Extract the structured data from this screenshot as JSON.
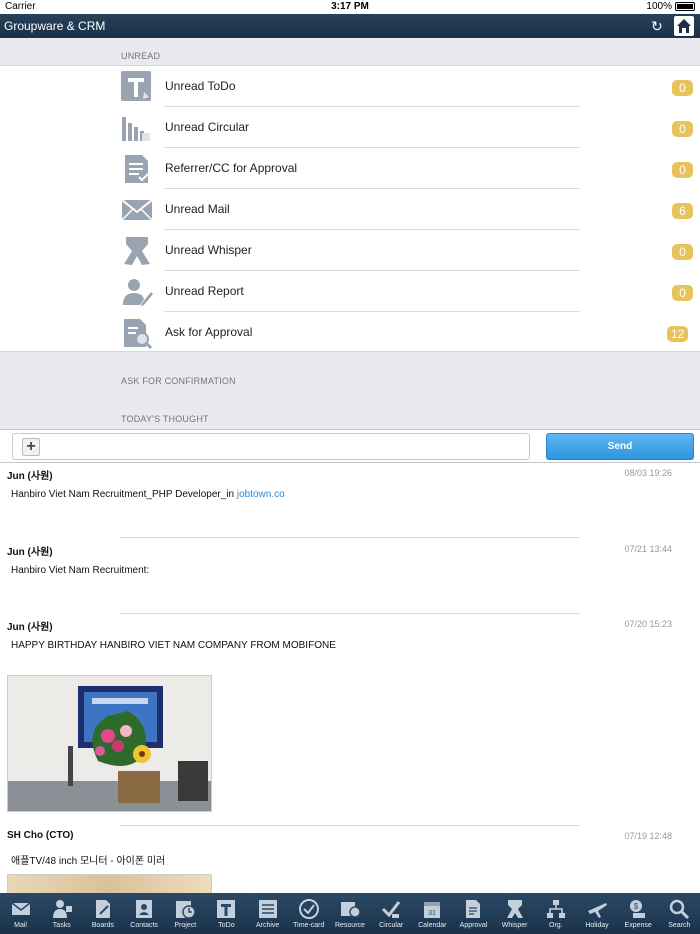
{
  "status_bar": {
    "carrier": "Carrier",
    "time": "3:17 PM",
    "battery": "100%"
  },
  "nav": {
    "title": "Groupware & CRM"
  },
  "sections": {
    "unread": "UNREAD",
    "confirmation": "ASK FOR CONFIRMATION",
    "thought": "TODAY'S THOUGHT"
  },
  "unread_items": [
    {
      "label": "Unread ToDo",
      "count": "0",
      "icon": "todo-icon"
    },
    {
      "label": "Unread Circular",
      "count": "0",
      "icon": "circular-icon"
    },
    {
      "label": "Referrer/CC for Approval",
      "count": "0",
      "icon": "document-check-icon"
    },
    {
      "label": "Unread Mail",
      "count": "6",
      "icon": "mail-icon"
    },
    {
      "label": "Unread Whisper",
      "count": "0",
      "icon": "whisper-icon"
    },
    {
      "label": "Unread Report",
      "count": "0",
      "icon": "report-icon"
    },
    {
      "label": "Ask for Approval",
      "count": "12",
      "icon": "approval-search-icon"
    }
  ],
  "composer": {
    "send_label": "Send"
  },
  "posts": [
    {
      "author": "Jun (사원)",
      "time": "08/03 19:26",
      "body": "Hanbiro Viet Nam Recruitment_PHP Developer_in ",
      "link": "jobtown.co"
    },
    {
      "author": "Jun (사원)",
      "time": "07/21 13:44",
      "body": "Hanbiro Viet Nam Recruitment:"
    },
    {
      "author": "Jun (사원)",
      "time": "07/20 15:23",
      "body": "HAPPY BIRTHDAY HANBIRO VIET NAM COMPANY FROM MOBIFONE"
    },
    {
      "author": "SH Cho (CTO)",
      "time": "07/19 12:48",
      "body": "애플TV/48 inch 모니터 - 아이폰 미러"
    }
  ],
  "tabs": [
    "Mail",
    "Tasks",
    "Boards",
    "Contacts",
    "Project",
    "ToDo",
    "Archive",
    "Time-card",
    "Resource",
    "Circular",
    "Calendar",
    "Approval",
    "Whisper",
    "Org.",
    "Holiday",
    "Expense",
    "Search"
  ]
}
